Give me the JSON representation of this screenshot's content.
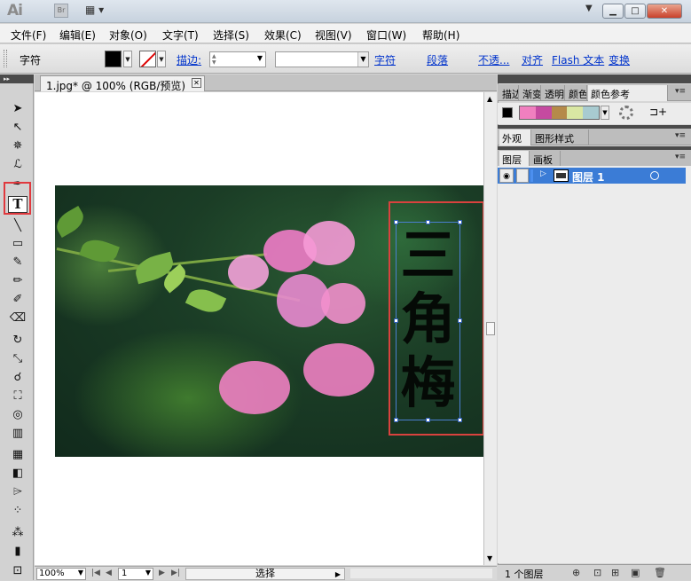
{
  "app": {
    "logo": "Ai",
    "bridge": "Br"
  },
  "menu": [
    "文件(F)",
    "编辑(E)",
    "对象(O)",
    "文字(T)",
    "选择(S)",
    "效果(C)",
    "视图(V)",
    "窗口(W)",
    "帮助(H)"
  ],
  "control": {
    "mode": "字符",
    "stroke_label": "描边:",
    "character_link": "字符",
    "paragraph_link": "段落",
    "opacity_link": "不透...",
    "align_link": "对齐",
    "flash_text_link": "Flash 文本",
    "transform_link": "变换",
    "fill_color": "#000000"
  },
  "document": {
    "tab_title": "1.jpg* @ 100% (RGB/预览)",
    "vertical_text": "三角梅"
  },
  "status": {
    "zoom": "100%",
    "page": "1",
    "label": "选择"
  },
  "panels": {
    "top_tabs": [
      "描边",
      "渐变",
      "透明",
      "颜色",
      "颜色参考"
    ],
    "appearance_tabs": [
      "外观",
      "图形样式"
    ],
    "layers_tabs": [
      "图层",
      "画板"
    ],
    "guide_colors": [
      "#f07fbf",
      "#c54aa0",
      "#b58a4a",
      "#d9e7a3",
      "#a8cbd0"
    ],
    "layer_name": "图层 1",
    "layer_count": "1 个图层"
  }
}
